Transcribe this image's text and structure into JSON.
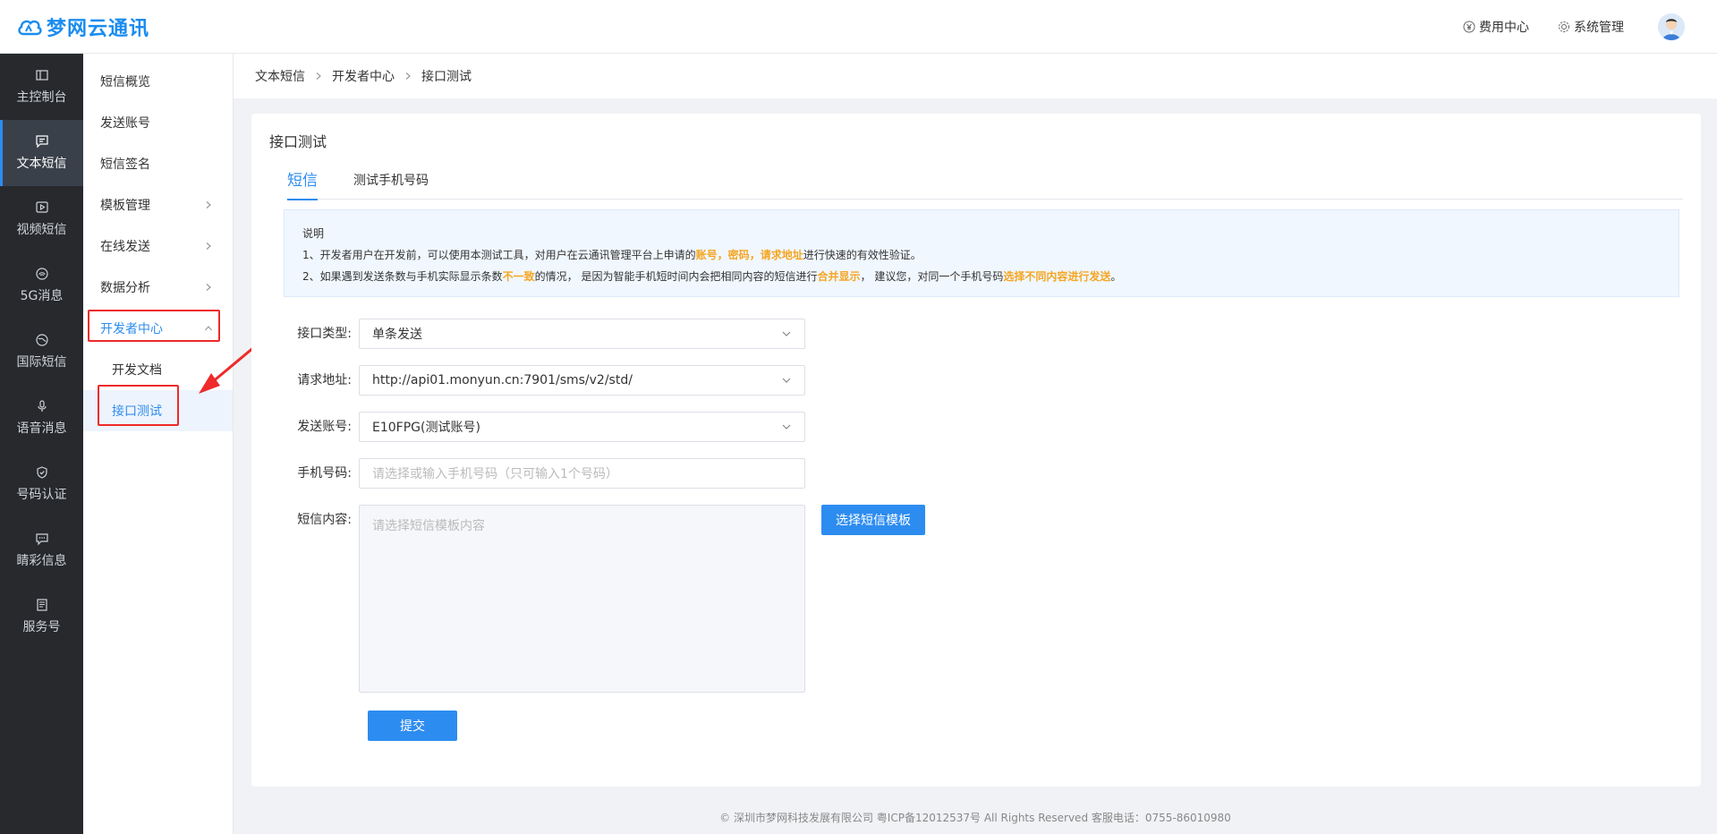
{
  "header": {
    "logo_text": "梦网云通讯",
    "billing_label": "费用中心",
    "system_label": "系统管理"
  },
  "leftnav": {
    "items": [
      {
        "label": "主控制台",
        "icon": "dashboard-icon"
      },
      {
        "label": "文本短信",
        "icon": "message-icon"
      },
      {
        "label": "视频短信",
        "icon": "video-icon"
      },
      {
        "label": "5G消息",
        "icon": "signal-icon"
      },
      {
        "label": "国际短信",
        "icon": "globe-icon"
      },
      {
        "label": "语音消息",
        "icon": "microphone-icon"
      },
      {
        "label": "号码认证",
        "icon": "shield-icon"
      },
      {
        "label": "睛彩信息",
        "icon": "chat-icon"
      },
      {
        "label": "服务号",
        "icon": "document-icon"
      }
    ]
  },
  "submenu": {
    "items": [
      {
        "label": "短信概览"
      },
      {
        "label": "发送账号"
      },
      {
        "label": "短信签名"
      },
      {
        "label": "模板管理"
      },
      {
        "label": "在线发送"
      },
      {
        "label": "数据分析"
      },
      {
        "label": "开发者中心"
      }
    ],
    "children": [
      {
        "label": "开发文档"
      },
      {
        "label": "接口测试"
      }
    ]
  },
  "breadcrumb": [
    "文本短信",
    "开发者中心",
    "接口测试"
  ],
  "card": {
    "title": "接口测试",
    "tabs": [
      "短信",
      "测试手机号码"
    ]
  },
  "notice": {
    "title": "说明",
    "line1_a": "1、开发者用户在开发前，可以使用本测试工具，对用户在云通讯管理平台上申请的",
    "line1_hl1": "账号",
    "line1_sep1": "，",
    "line1_hl2": "密码",
    "line1_sep2": "，",
    "line1_hl3": "请求地址",
    "line1_b": "进行快速的有效性验证。",
    "line2_a": "2、如果遇到发送条数与手机实际显示条数",
    "line2_hl1": "不一致",
    "line2_b": "的情况， 是因为智能手机短时间内会把相同内容的短信进行",
    "line2_hl2": "合并显示",
    "line2_c": "， 建议您，对同一个手机号码",
    "line2_hl3": "选择不同内容进行发送",
    "line2_d": "。"
  },
  "form": {
    "type_label": "接口类型:",
    "type_value": "单条发送",
    "url_label": "请求地址:",
    "url_value": "http://api01.monyun.cn:7901/sms/v2/std/",
    "account_label": "发送账号:",
    "account_value": "E10FPG(测试账号)",
    "phone_label": "手机号码:",
    "phone_placeholder": "请选择或输入手机号码（只可输入1个号码）",
    "content_label": "短信内容:",
    "content_placeholder": "请选择短信模板内容",
    "template_button": "选择短信模板",
    "submit_button": "提交"
  },
  "footer": {
    "text": "© 深圳市梦网科技发展有限公司 粤ICP备12012537号 All Rights Reserved 客服电话：0755-86010980"
  },
  "colors": {
    "accent": "#2d8cf0",
    "highlight": "#f5a623",
    "annotation": "#ee2a2a",
    "nav_bg": "#27292d"
  }
}
